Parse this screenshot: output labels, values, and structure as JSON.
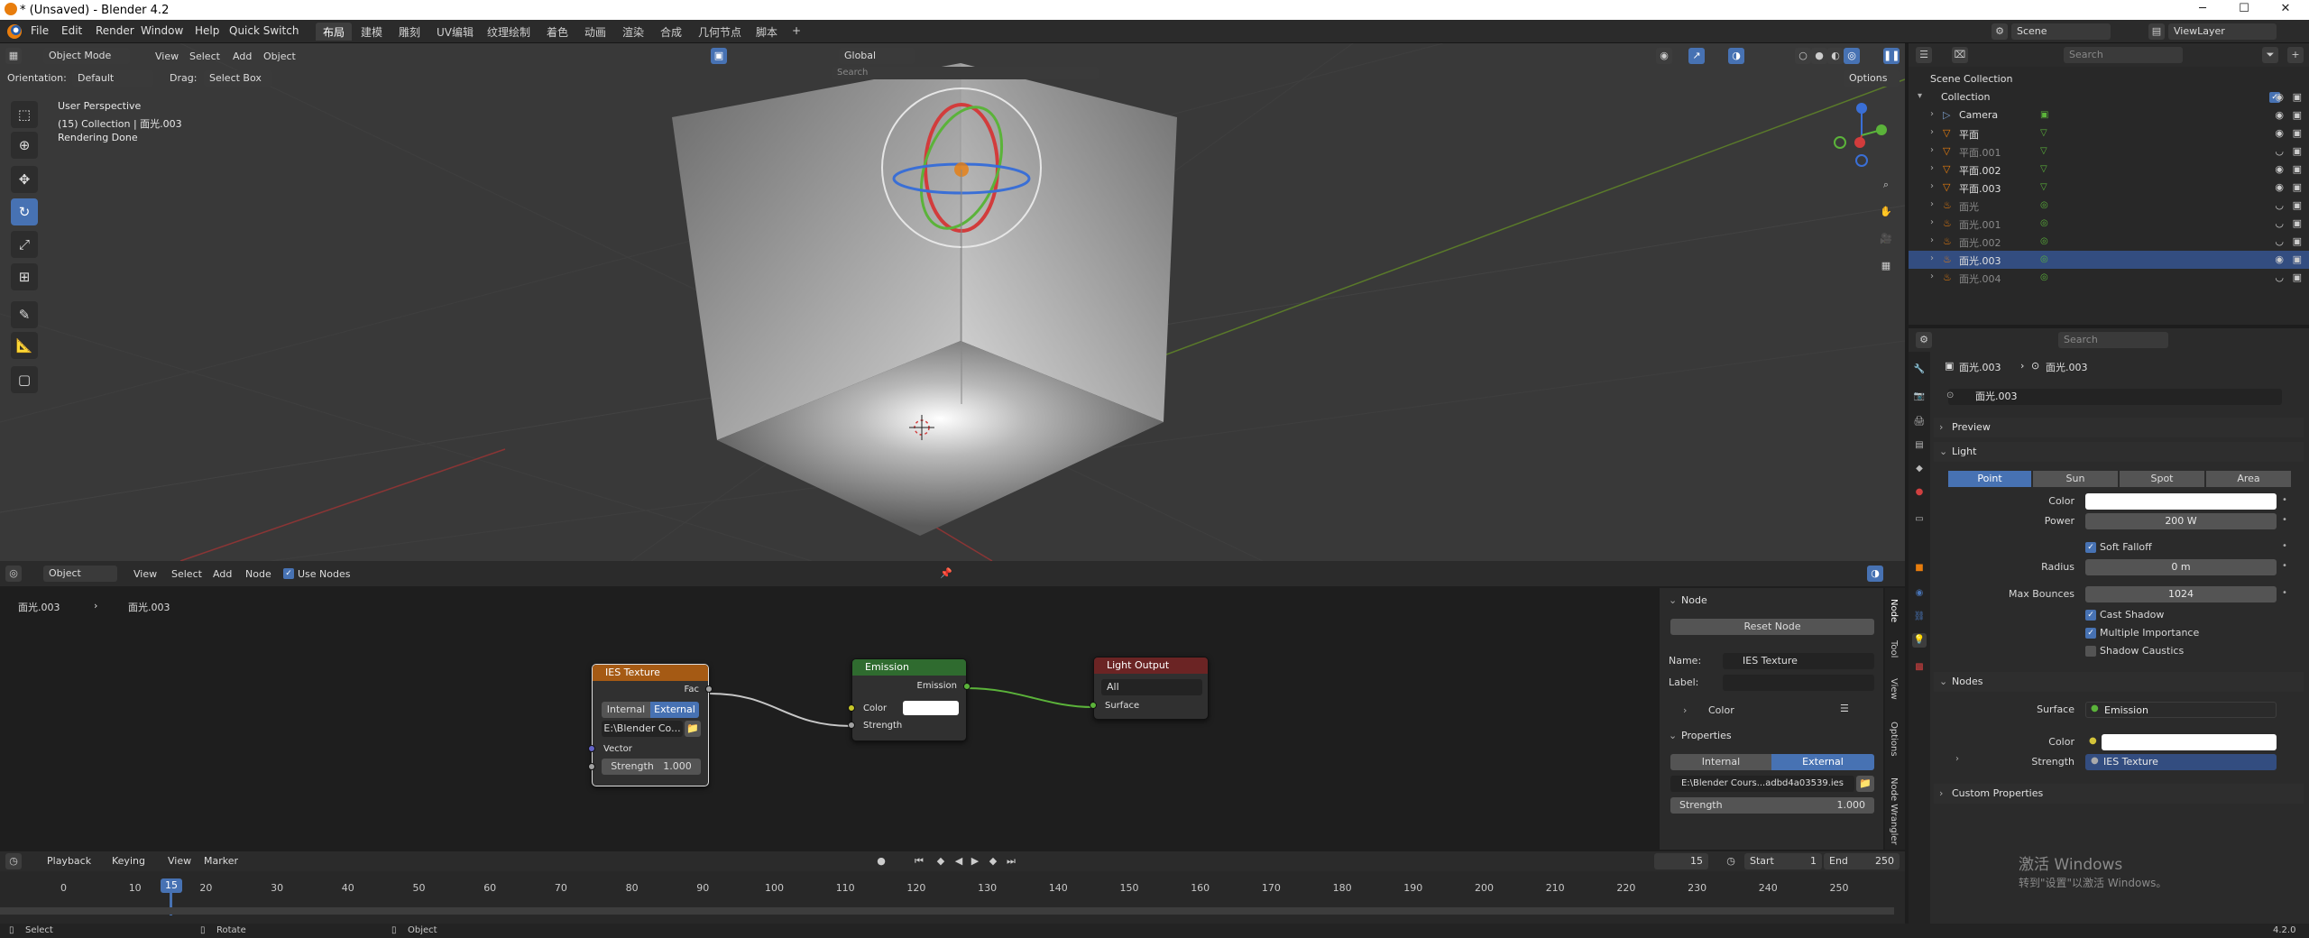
{
  "titlebar": {
    "title": "* (Unsaved) - Blender 4.2"
  },
  "menu": {
    "items": [
      "File",
      "Edit",
      "Render",
      "Window",
      "Help",
      "Quick Switch"
    ],
    "workspaces": [
      "布局",
      "建模",
      "雕刻",
      "UV编辑",
      "纹理绘制",
      "着色",
      "动画",
      "渲染",
      "合成",
      "几何节点",
      "脚本"
    ],
    "add_tab": "+",
    "scene": "Scene",
    "viewlayer": "ViewLayer"
  },
  "viewport": {
    "mode": "Object Mode",
    "menus": [
      "View",
      "Select",
      "Add",
      "Object"
    ],
    "transform_orientation": "Global",
    "orientation_label": "Orientation:",
    "orientation_value": "Default",
    "drag_label": "Drag:",
    "drag_value": "Select Box",
    "options": "Options",
    "search_placeholder": "Search",
    "overlay_line1": "User Perspective",
    "overlay_line2": "(15) Collection | 面光.003",
    "overlay_line3": "Rendering Done"
  },
  "outliner": {
    "search_placeholder": "Search",
    "root": "Scene Collection",
    "collection": "Collection",
    "items": [
      {
        "name": "Camera",
        "type": "camera",
        "dim": false,
        "selected": false
      },
      {
        "name": "平面",
        "type": "mesh",
        "dim": false,
        "selected": false
      },
      {
        "name": "平面.001",
        "type": "mesh",
        "dim": true,
        "selected": false
      },
      {
        "name": "平面.002",
        "type": "mesh",
        "dim": false,
        "selected": false
      },
      {
        "name": "平面.003",
        "type": "mesh",
        "dim": false,
        "selected": false
      },
      {
        "name": "面光",
        "type": "light",
        "dim": true,
        "selected": false
      },
      {
        "name": "面光.001",
        "type": "light",
        "dim": true,
        "selected": false
      },
      {
        "name": "面光.002",
        "type": "light",
        "dim": true,
        "selected": false
      },
      {
        "name": "面光.003",
        "type": "light",
        "dim": false,
        "selected": true
      },
      {
        "name": "面光.004",
        "type": "light",
        "dim": true,
        "selected": false
      }
    ]
  },
  "properties": {
    "search_placeholder": "Search",
    "breadcrumb_obj": "面光.003",
    "breadcrumb_data": "面光.003",
    "datablock": "面光.003",
    "preview": "Preview",
    "light_section": "Light",
    "light_types": [
      "Point",
      "Sun",
      "Spot",
      "Area"
    ],
    "active_light_type": "Point",
    "color_label": "Color",
    "power_label": "Power",
    "power_value": "200 W",
    "soft_falloff": "Soft Falloff",
    "radius_label": "Radius",
    "radius_value": "0 m",
    "max_bounces_label": "Max Bounces",
    "max_bounces_value": "1024",
    "cast_shadow": "Cast Shadow",
    "multiple_importance": "Multiple Importance",
    "shadow_caustics": "Shadow Caustics",
    "nodes_section": "Nodes",
    "surface_label": "Surface",
    "surface_value": "Emission",
    "nodes_color_label": "Color",
    "strength_label": "Strength",
    "strength_value": "IES Texture",
    "custom_props": "Custom Properties"
  },
  "node_editor": {
    "type": "Object",
    "menus": [
      "View",
      "Select",
      "Add",
      "Node"
    ],
    "use_nodes": "Use Nodes",
    "breadcrumb_obj": "面光.003",
    "breadcrumb_data": "面光.003",
    "ies_node": {
      "title": "IES Texture",
      "output": "Fac",
      "mode_internal": "Internal",
      "mode_external": "External",
      "filepath": "E:\\Blender Co...",
      "vector": "Vector",
      "strength_label": "Strength",
      "strength_value": "1.000"
    },
    "emission_node": {
      "title": "Emission",
      "output": "Emission",
      "color": "Color",
      "strength": "Strength"
    },
    "output_node": {
      "title": "Light Output",
      "target": "All",
      "surface": "Surface"
    },
    "npanel": {
      "node_section": "Node",
      "reset_node": "Reset Node",
      "name_label": "Name:",
      "name_value": "IES Texture",
      "label_label": "Label:",
      "color_sub": "Color",
      "properties_section": "Properties",
      "internal": "Internal",
      "external": "External",
      "filepath": "E:\\Blender Cours...adbd4a03539.ies",
      "strength_label": "Strength",
      "strength_value": "1.000",
      "tabs": [
        "Node",
        "Tool",
        "View",
        "Options",
        "Node Wrangler"
      ]
    }
  },
  "timeline": {
    "menus": [
      "Playback",
      "Keying",
      "View",
      "Marker"
    ],
    "current_frame": "15",
    "start_label": "Start",
    "start_value": "1",
    "end_label": "End",
    "end_value": "250",
    "ticks": [
      "0",
      "10",
      "20",
      "30",
      "40",
      "50",
      "60",
      "70",
      "80",
      "90",
      "100",
      "110",
      "120",
      "130",
      "140",
      "150",
      "160",
      "170",
      "180",
      "190",
      "200",
      "210",
      "220",
      "230",
      "240",
      "250"
    ]
  },
  "statusbar": {
    "select": "Select",
    "rotate": "Rotate",
    "object": "Object",
    "version": "4.2.0"
  },
  "watermark": {
    "line1": "激活 Windows",
    "line2": "转到\"设置\"以激活 Windows。"
  },
  "colors": {
    "accent": "#4772b3",
    "selection": "#334d80",
    "ies_header": "#a55a14",
    "emission_header": "#2f6b2f",
    "output_header": "#6b2424"
  }
}
